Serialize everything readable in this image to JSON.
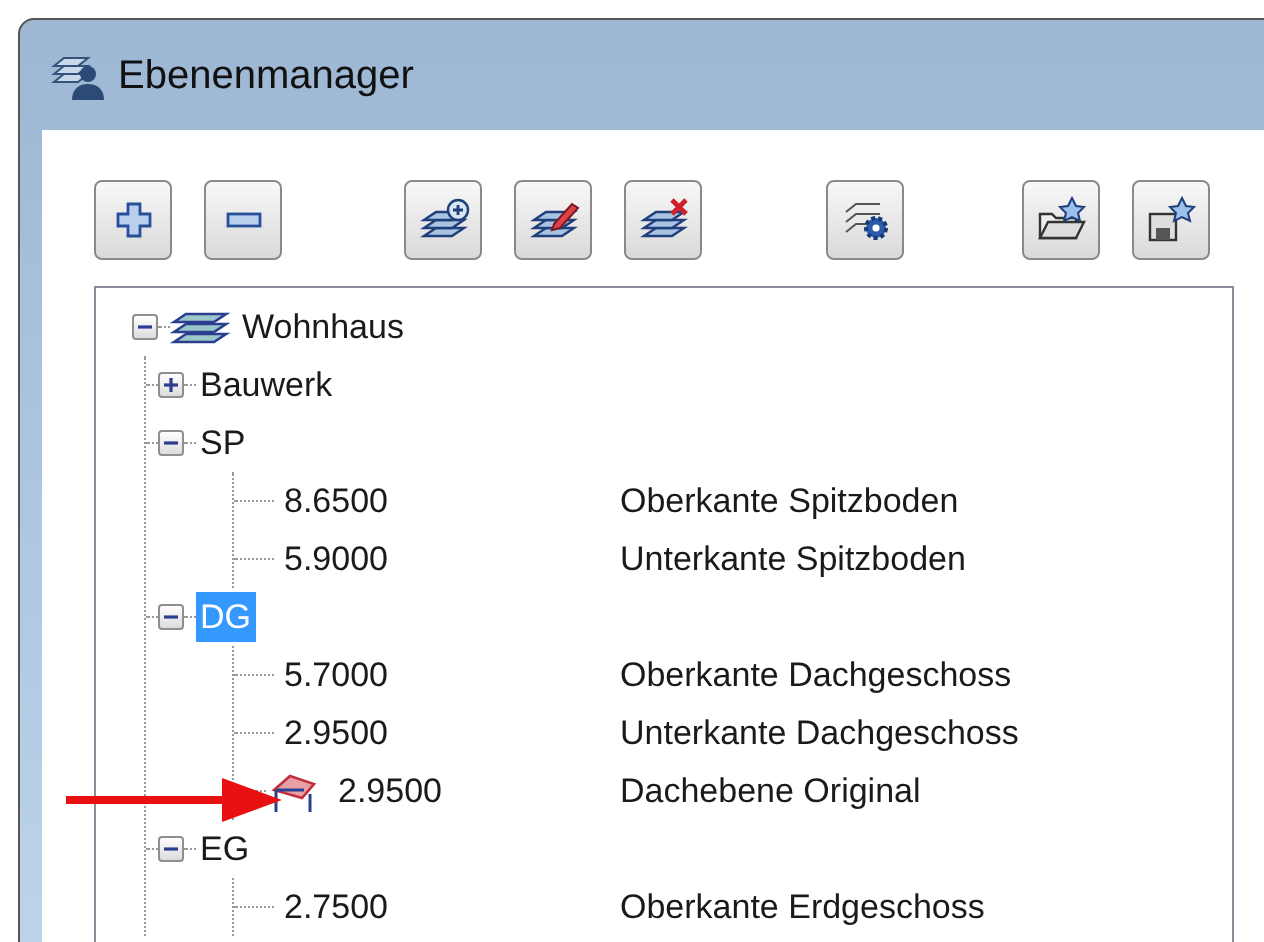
{
  "window": {
    "title": "Ebenenmanager"
  },
  "tree": {
    "label": "Wohnhaus",
    "expanded": true,
    "selected": false,
    "children": [
      {
        "label": "Bauwerk",
        "expanded": false,
        "selected": false
      },
      {
        "label": "SP",
        "expanded": true,
        "selected": false,
        "children": [
          {
            "kind": "level",
            "value": "8.6500",
            "description": "Oberkante Spitzboden",
            "selected": false
          },
          {
            "kind": "level",
            "value": "5.9000",
            "description": "Unterkante Spitzboden",
            "selected": false
          }
        ]
      },
      {
        "label": "DG",
        "expanded": true,
        "selected": true,
        "children": [
          {
            "kind": "level",
            "value": "5.7000",
            "description": "Oberkante Dachgeschoss",
            "selected": false
          },
          {
            "kind": "level",
            "value": "2.9500",
            "description": "Unterkante Dachgeschoss",
            "selected": false
          },
          {
            "kind": "roof",
            "value": "2.9500",
            "description": "Dachebene Original",
            "selected": false
          }
        ]
      },
      {
        "label": "EG",
        "expanded": true,
        "selected": false,
        "children": [
          {
            "kind": "level",
            "value": "2.7500",
            "description": "Oberkante Erdgeschoss",
            "selected": false
          }
        ]
      }
    ]
  }
}
